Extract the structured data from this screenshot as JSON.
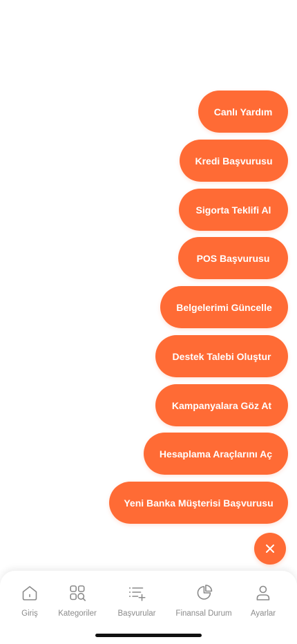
{
  "colors": {
    "accent": "#ff6b35",
    "tab_label": "#8a8a8a",
    "tab_icon": "#8a8a8a"
  },
  "fab_menu": {
    "items": [
      {
        "label": "Canlı Yardım"
      },
      {
        "label": "Kredi Başvurusu"
      },
      {
        "label": "Sigorta Teklifi Al"
      },
      {
        "label": "POS Başvurusu"
      },
      {
        "label": "Belgelerimi Güncelle"
      },
      {
        "label": "Destek Talebi Oluştur"
      },
      {
        "label": "Kampanyalara Göz At"
      },
      {
        "label": "Hesaplama Araçlarını Aç"
      },
      {
        "label": "Yeni Banka Müşterisi Başvurusu"
      }
    ],
    "close_icon": "close-icon"
  },
  "tabbar": {
    "items": [
      {
        "label": "Giriş",
        "icon": "home-icon"
      },
      {
        "label": "Kategoriler",
        "icon": "category-search-icon"
      },
      {
        "label": "Başvurular",
        "icon": "list-add-icon"
      },
      {
        "label": "Finansal Durum",
        "icon": "pie-chart-icon"
      },
      {
        "label": "Ayarlar",
        "icon": "user-icon"
      }
    ]
  }
}
